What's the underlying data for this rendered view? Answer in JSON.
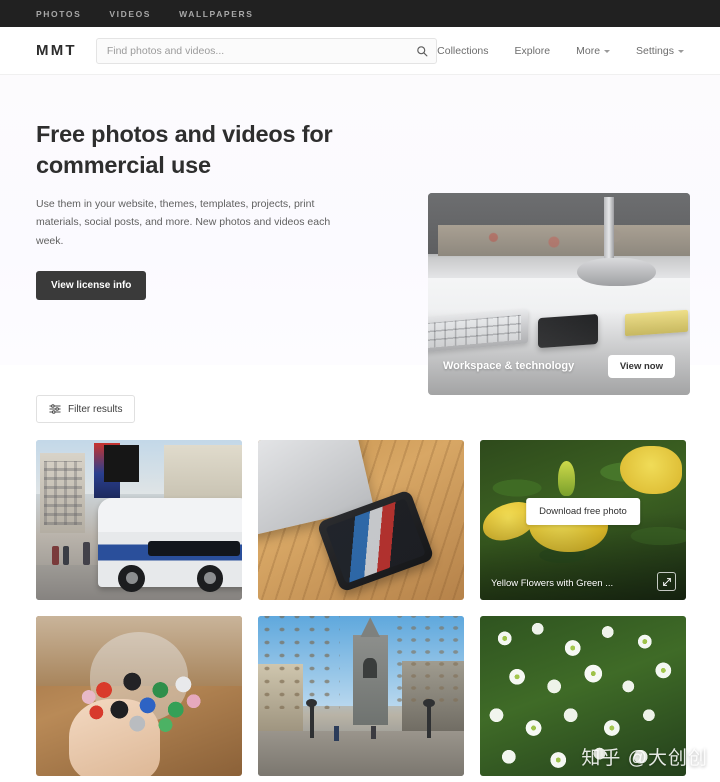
{
  "topbar": {
    "links": [
      {
        "label": "PHOTOS",
        "name": "topbar-link-photos"
      },
      {
        "label": "VIDEOS",
        "name": "topbar-link-videos"
      },
      {
        "label": "WALLPAPERS",
        "name": "topbar-link-wallpapers"
      }
    ]
  },
  "header": {
    "logo": "MMT",
    "search": {
      "placeholder": "Find photos and videos...",
      "value": "",
      "icon": "search-icon"
    },
    "nav": [
      {
        "label": "Collections",
        "caret": false
      },
      {
        "label": "Explore",
        "caret": false
      },
      {
        "label": "More",
        "caret": true
      },
      {
        "label": "Settings",
        "caret": true
      }
    ]
  },
  "hero": {
    "title": "Free photos and videos for commercial use",
    "subtitle": "Use them in your website, themes, templates, projects, print materials, social posts, and more. New photos and videos each week.",
    "button": "View license info",
    "card": {
      "label": "Workspace & technology",
      "button": "View now",
      "alt": "desk-with-keyboard-phone-and-lamp"
    }
  },
  "results": {
    "filter_button": "Filter results",
    "filter_icon": "sliders-icon",
    "cards": [
      {
        "alt": "city-street-with-bus",
        "art": "photo-bus",
        "caption": "",
        "hovered": false
      },
      {
        "alt": "laptop-and-smartphone-on-wooden-table",
        "art": "photo-desk2",
        "caption": "",
        "hovered": false
      },
      {
        "alt": "yellow-flowers-with-green-leaves",
        "art": "photo-yellow",
        "caption": "Yellow Flowers with Green ...",
        "hovered": true,
        "download_label": "Download free photo",
        "expand_icon": "expand-icon"
      },
      {
        "alt": "hand-holding-colorful-markers",
        "art": "photo-markers",
        "caption": "",
        "hovered": false
      },
      {
        "alt": "park-promenade-with-clock-tower",
        "art": "photo-park",
        "caption": "",
        "hovered": false
      },
      {
        "alt": "white-alyssum-flowers",
        "art": "photo-white",
        "caption": "",
        "hovered": false
      }
    ]
  },
  "watermark": "知乎 @大创创",
  "colors": {
    "topbar_bg": "#212121",
    "button_dark": "#3a3a3a",
    "text_primary": "#2e2e2e",
    "text_muted": "#6d6d6d",
    "hero_bg": "#fbfaff"
  }
}
